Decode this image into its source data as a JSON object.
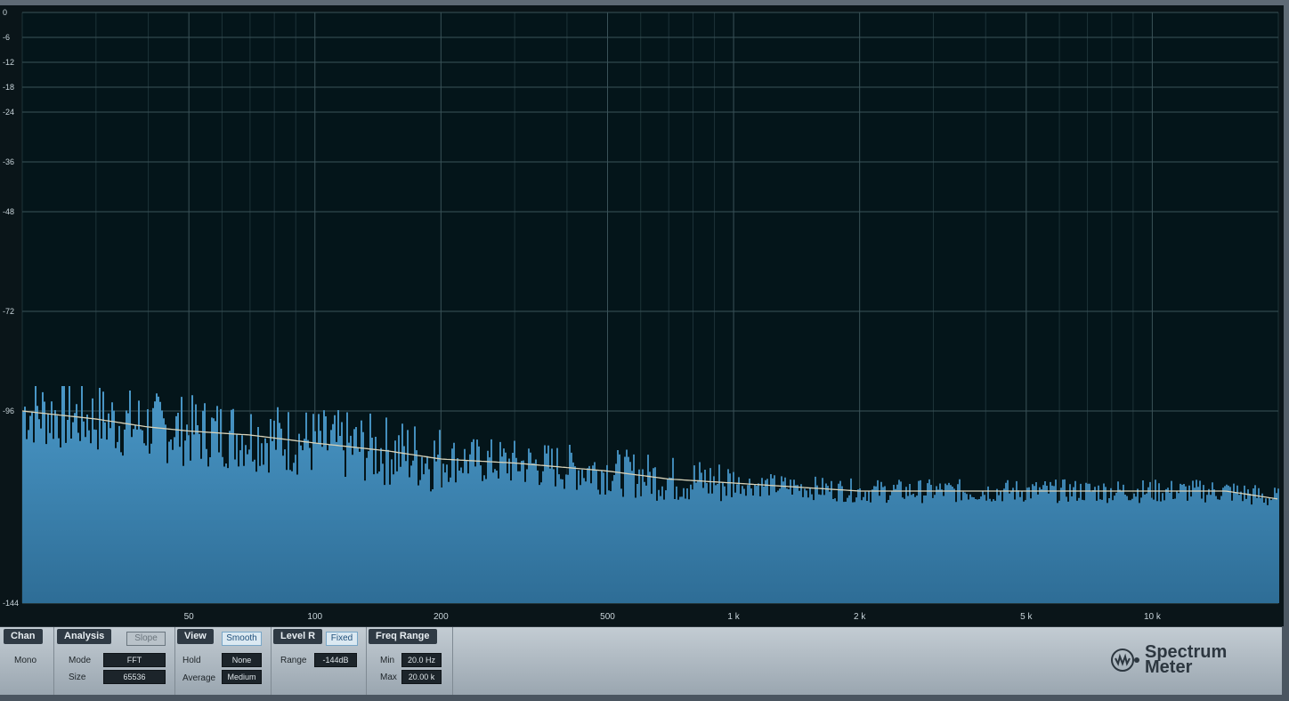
{
  "plot": {
    "y_ticks": [
      {
        "label": "0",
        "db": 0
      },
      {
        "label": "-6",
        "db": -6
      },
      {
        "label": "-12",
        "db": -12
      },
      {
        "label": "-18",
        "db": -18
      },
      {
        "label": "-24",
        "db": -24
      },
      {
        "label": "-36",
        "db": -36
      },
      {
        "label": "-48",
        "db": -48
      },
      {
        "label": "-72",
        "db": -72
      },
      {
        "label": "-96",
        "db": -96
      },
      {
        "label": "-144",
        "db": -144
      }
    ],
    "x_ticks": [
      {
        "label": "50",
        "hz": 50
      },
      {
        "label": "100",
        "hz": 100
      },
      {
        "label": "200",
        "hz": 200
      },
      {
        "label": "500",
        "hz": 500
      },
      {
        "label": "1 k",
        "hz": 1000
      },
      {
        "label": "2 k",
        "hz": 2000
      },
      {
        "label": "5 k",
        "hz": 5000
      },
      {
        "label": "10 k",
        "hz": 10000
      }
    ],
    "colors": {
      "background": "#04151a",
      "grid": "#3a5258",
      "bars": "#3d89bb",
      "curve": "#d8d2b8"
    }
  },
  "chart_data": {
    "type": "bar",
    "x_scale": "log",
    "xlim": [
      20,
      20000
    ],
    "ylim": [
      -144,
      0
    ],
    "grid": true,
    "curve_points": [
      [
        20,
        -96
      ],
      [
        30,
        -98
      ],
      [
        40,
        -100
      ],
      [
        50,
        -101
      ],
      [
        70,
        -102
      ],
      [
        100,
        -104
      ],
      [
        150,
        -106
      ],
      [
        200,
        -108
      ],
      [
        300,
        -109
      ],
      [
        500,
        -111
      ],
      [
        700,
        -113
      ],
      [
        1000,
        -114
      ],
      [
        2000,
        -116
      ],
      [
        5000,
        -116
      ],
      [
        10000,
        -116
      ],
      [
        15000,
        -116
      ],
      [
        20000,
        -118
      ]
    ]
  },
  "panel": {
    "chan": {
      "title": "Chan",
      "mode": "Mono"
    },
    "analysis": {
      "title": "Analysis",
      "slope": "Slope",
      "mode_label": "Mode",
      "mode_value": "FFT",
      "size_label": "Size",
      "size_value": "65536"
    },
    "view": {
      "title": "View",
      "smooth": "Smooth",
      "hold_label": "Hold",
      "hold_value": "None",
      "average_label": "Average",
      "average_value": "Medium"
    },
    "level": {
      "title": "Level R",
      "fixed": "Fixed",
      "range_label": "Range",
      "range_value": "-144dB"
    },
    "freq": {
      "title": "Freq Range",
      "min_label": "Min",
      "min_value": "20.0 Hz",
      "max_label": "Max",
      "max_value": "20.00 k"
    },
    "logo": {
      "line1": "Spectrum",
      "line2": "Meter",
      "icon": "presonus-logo-icon"
    }
  }
}
